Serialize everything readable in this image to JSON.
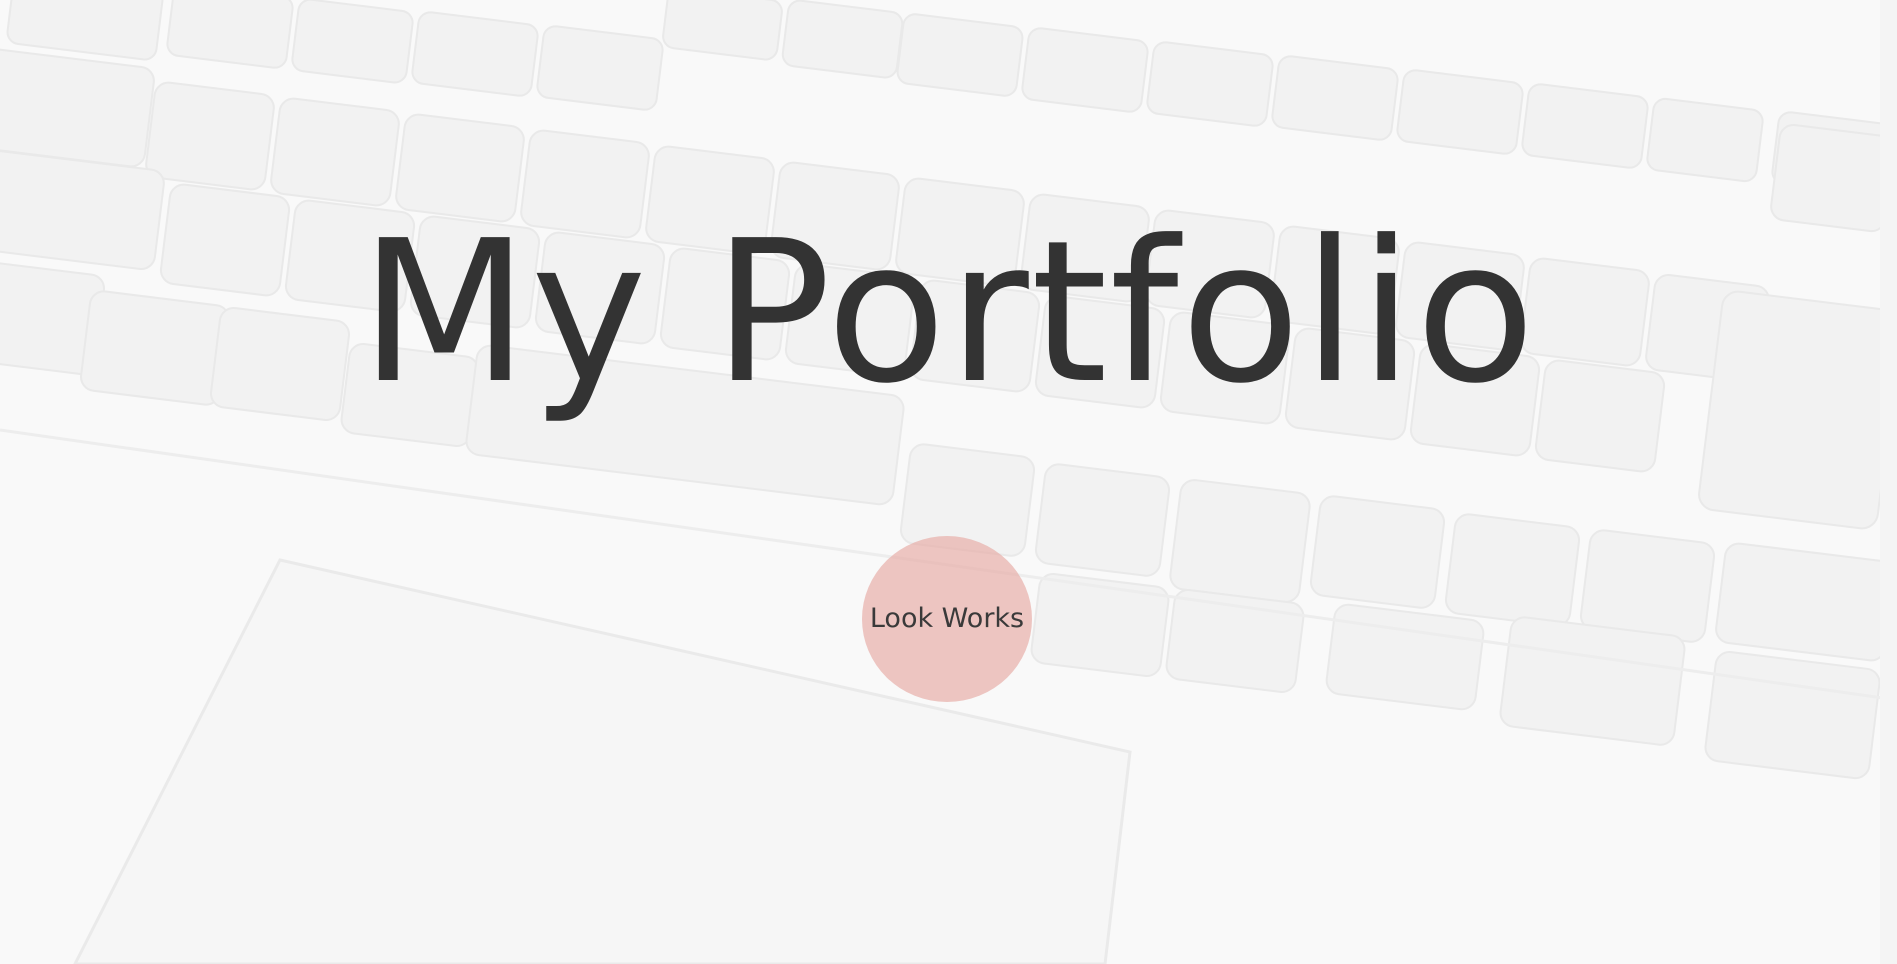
{
  "hero": {
    "title": "My Portfolio",
    "background_icon": "keyboard-icon",
    "cta_label": "Look Works"
  },
  "colors": {
    "title": "#333333",
    "cta_fill": "#e8b0aa",
    "background": "#f7f7f7"
  }
}
